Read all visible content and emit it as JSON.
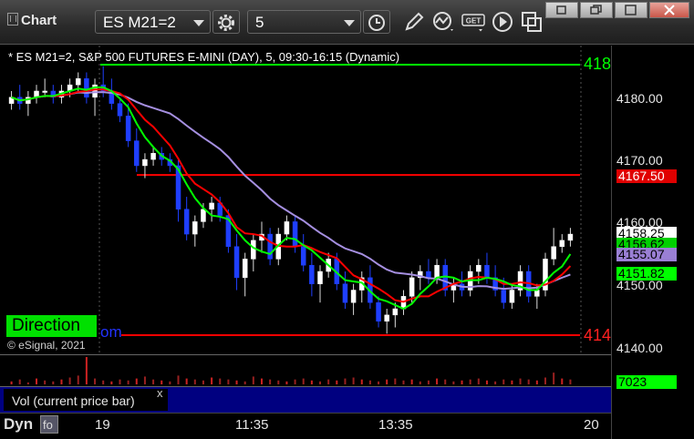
{
  "toolbar": {
    "title": "Chart",
    "symbol": "ES M21=2",
    "interval": "5"
  },
  "chart": {
    "title": "* ES M21=2, S&P 500 FUTURES E-MINI (DAY), 5, 09:30-16:15 (Dynamic)",
    "copyright": "© eSignal, 2021",
    "direction_label": "Direction",
    "partial_label": "om",
    "edge_top": "418",
    "edge_bottom": "414"
  },
  "price_axis": {
    "ticks": [
      "4180.00",
      "4170.00",
      "4160.00",
      "4150.00",
      "4140.00"
    ],
    "tags": [
      {
        "value": "4167.50",
        "bg": "#e00000",
        "color": "#ffffff"
      },
      {
        "value": "4158.25",
        "bg": "#ffffff",
        "color": "#000000"
      },
      {
        "value": "4156.62",
        "bg": "#00d000",
        "color": "#000000"
      },
      {
        "value": "4155.07",
        "bg": "#9a7fd4",
        "color": "#000000"
      },
      {
        "value": "4151.82",
        "bg": "#00ff00",
        "color": "#000000"
      }
    ],
    "volume_tag": "7023"
  },
  "volume": {
    "label": "Vol (current price bar)",
    "close": "x"
  },
  "time_axis": {
    "labels": [
      "19",
      "11:35",
      "13:35",
      "20"
    ],
    "mode": "Dyn"
  },
  "colors": {
    "green": "#00ff00",
    "red": "#ff0000",
    "purple": "#a58fe0",
    "candle_up": "#ffffff",
    "candle_down": "#1f3fff"
  },
  "chart_data": {
    "type": "candlestick",
    "ylim": [
      4138,
      4188
    ],
    "levels": {
      "upper_green": 4185,
      "red_resistance": 4167.5,
      "red_support": 4141
    },
    "candles": [
      [
        4179,
        4181,
        4178,
        4180
      ],
      [
        4180,
        4182,
        4178,
        4179
      ],
      [
        4179,
        4181,
        4177,
        4180
      ],
      [
        4180,
        4182,
        4179,
        4181
      ],
      [
        4181,
        4183,
        4180,
        4181
      ],
      [
        4181,
        4182,
        4179,
        4180
      ],
      [
        4180,
        4182,
        4179,
        4181
      ],
      [
        4181,
        4183,
        4180,
        4182
      ],
      [
        4182,
        4184,
        4181,
        4183
      ],
      [
        4183,
        4184,
        4179,
        4180
      ],
      [
        4180,
        4183,
        4177,
        4182
      ],
      [
        4182,
        4185,
        4180,
        4181
      ],
      [
        4181,
        4183,
        4178,
        4179
      ],
      [
        4179,
        4180,
        4176,
        4177
      ],
      [
        4177,
        4179,
        4172,
        4173
      ],
      [
        4173,
        4175,
        4168,
        4169
      ],
      [
        4169,
        4171,
        4167,
        4170
      ],
      [
        4170,
        4172,
        4169,
        4171
      ],
      [
        4171,
        4172,
        4169,
        4170
      ],
      [
        4170,
        4171,
        4168,
        4169
      ],
      [
        4169,
        4170,
        4160,
        4162
      ],
      [
        4162,
        4164,
        4157,
        4158
      ],
      [
        4158,
        4161,
        4156,
        4160
      ],
      [
        4160,
        4163,
        4159,
        4162
      ],
      [
        4162,
        4164,
        4160,
        4163
      ],
      [
        4163,
        4164,
        4160,
        4161
      ],
      [
        4161,
        4162,
        4155,
        4156
      ],
      [
        4156,
        4158,
        4149,
        4151
      ],
      [
        4151,
        4155,
        4148,
        4154
      ],
      [
        4154,
        4158,
        4152,
        4157
      ],
      [
        4157,
        4160,
        4155,
        4158
      ],
      [
        4158,
        4159,
        4153,
        4154
      ],
      [
        4154,
        4159,
        4153,
        4158
      ],
      [
        4158,
        4161,
        4157,
        4160
      ],
      [
        4160,
        4161,
        4155,
        4156
      ],
      [
        4156,
        4158,
        4152,
        4153
      ],
      [
        4153,
        4155,
        4148,
        4150
      ],
      [
        4150,
        4153,
        4147,
        4152
      ],
      [
        4152,
        4155,
        4151,
        4154
      ],
      [
        4154,
        4155,
        4149,
        4150
      ],
      [
        4150,
        4152,
        4146,
        4147
      ],
      [
        4147,
        4150,
        4145,
        4149
      ],
      [
        4149,
        4152,
        4147,
        4151
      ],
      [
        4151,
        4153,
        4146,
        4147
      ],
      [
        4147,
        4148,
        4143,
        4144
      ],
      [
        4144,
        4146,
        4142,
        4145
      ],
      [
        4145,
        4147,
        4143,
        4146
      ],
      [
        4146,
        4149,
        4145,
        4148
      ],
      [
        4148,
        4152,
        4147,
        4151
      ],
      [
        4151,
        4153,
        4149,
        4152
      ],
      [
        4152,
        4154,
        4150,
        4151
      ],
      [
        4151,
        4154,
        4150,
        4153
      ],
      [
        4153,
        4154,
        4148,
        4149
      ],
      [
        4149,
        4151,
        4147,
        4150
      ],
      [
        4150,
        4152,
        4148,
        4149
      ],
      [
        4149,
        4153,
        4148,
        4152
      ],
      [
        4152,
        4154,
        4150,
        4153
      ],
      [
        4153,
        4155,
        4150,
        4151
      ],
      [
        4151,
        4153,
        4148,
        4149
      ],
      [
        4149,
        4151,
        4146,
        4147
      ],
      [
        4147,
        4150,
        4146,
        4149
      ],
      [
        4149,
        4153,
        4148,
        4152
      ],
      [
        4152,
        4153,
        4147,
        4148
      ],
      [
        4148,
        4150,
        4146,
        4149
      ],
      [
        4149,
        4155,
        4148,
        4154
      ],
      [
        4154,
        4159,
        4153,
        4156
      ],
      [
        4156,
        4158,
        4155,
        4157
      ],
      [
        4157,
        4159,
        4156,
        4158
      ]
    ],
    "volume": [
      3,
      5,
      2,
      6,
      4,
      3,
      5,
      7,
      9,
      28,
      6,
      4,
      3,
      5,
      4,
      6,
      8,
      5,
      4,
      3,
      9,
      6,
      5,
      4,
      7,
      6,
      5,
      4,
      3,
      8,
      6,
      5,
      4,
      3,
      5,
      6,
      4,
      3,
      5,
      4,
      6,
      7,
      5,
      4,
      3,
      5,
      6,
      4,
      5,
      3,
      4,
      6,
      5,
      3,
      4,
      5,
      6,
      4,
      3,
      5,
      4,
      6,
      5,
      4,
      7,
      12,
      6,
      5
    ]
  }
}
